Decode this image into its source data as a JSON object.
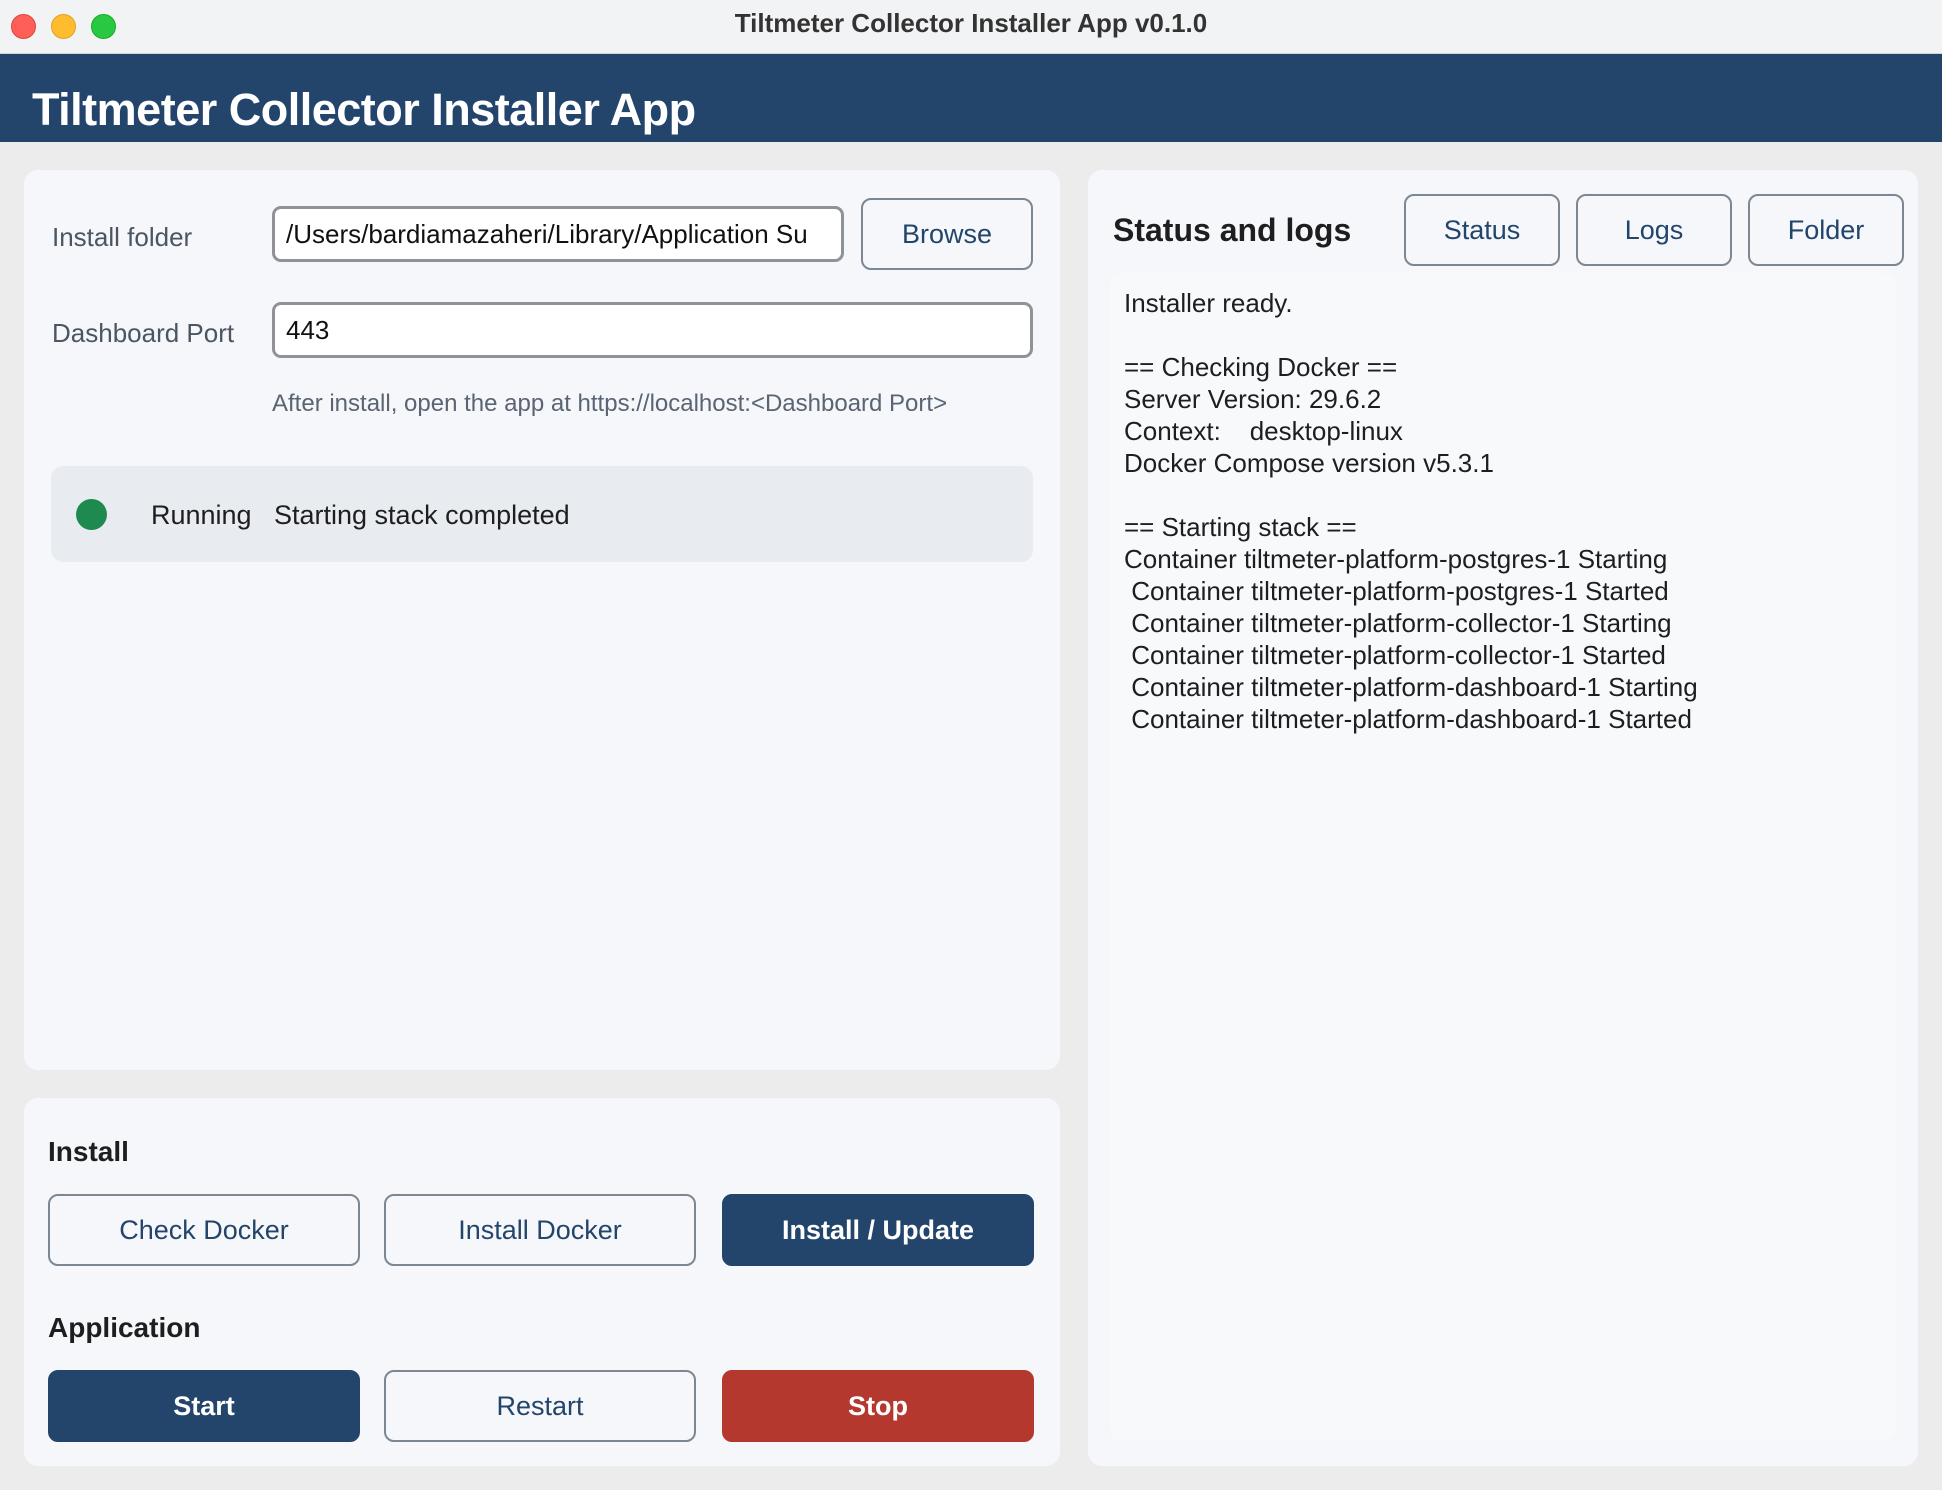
{
  "window": {
    "title": "Tiltmeter Collector Installer App v0.1.0"
  },
  "header": {
    "title": "Tiltmeter Collector Installer App"
  },
  "config": {
    "install_folder_label": "Install folder",
    "install_folder_value": "/Users/bardiamazaheri/Library/Application Su",
    "browse_label": "Browse",
    "dashboard_port_label": "Dashboard Port",
    "dashboard_port_value": "443",
    "hint": "After install, open the app at https://localhost:<Dashboard Port>"
  },
  "status": {
    "state": "Running",
    "message": "Starting stack completed",
    "color": "#1f8a4f"
  },
  "install_section": {
    "title": "Install",
    "check_docker_label": "Check Docker",
    "install_docker_label": "Install Docker",
    "install_update_label": "Install / Update"
  },
  "application_section": {
    "title": "Application",
    "start_label": "Start",
    "restart_label": "Restart",
    "stop_label": "Stop"
  },
  "logs": {
    "title": "Status and logs",
    "status_button": "Status",
    "logs_button": "Logs",
    "folder_button": "Folder",
    "text": "Installer ready.\n\n== Checking Docker ==\nServer Version: 29.6.2\nContext:    desktop-linux\nDocker Compose version v5.3.1\n\n== Starting stack ==\nContainer tiltmeter-platform-postgres-1 Starting\n Container tiltmeter-platform-postgres-1 Started\n Container tiltmeter-platform-collector-1 Starting\n Container tiltmeter-platform-collector-1 Started\n Container tiltmeter-platform-dashboard-1 Starting\n Container tiltmeter-platform-dashboard-1 Started"
  },
  "colors": {
    "brand": "#23456b",
    "danger": "#b5382f",
    "running": "#1f8a4f"
  }
}
